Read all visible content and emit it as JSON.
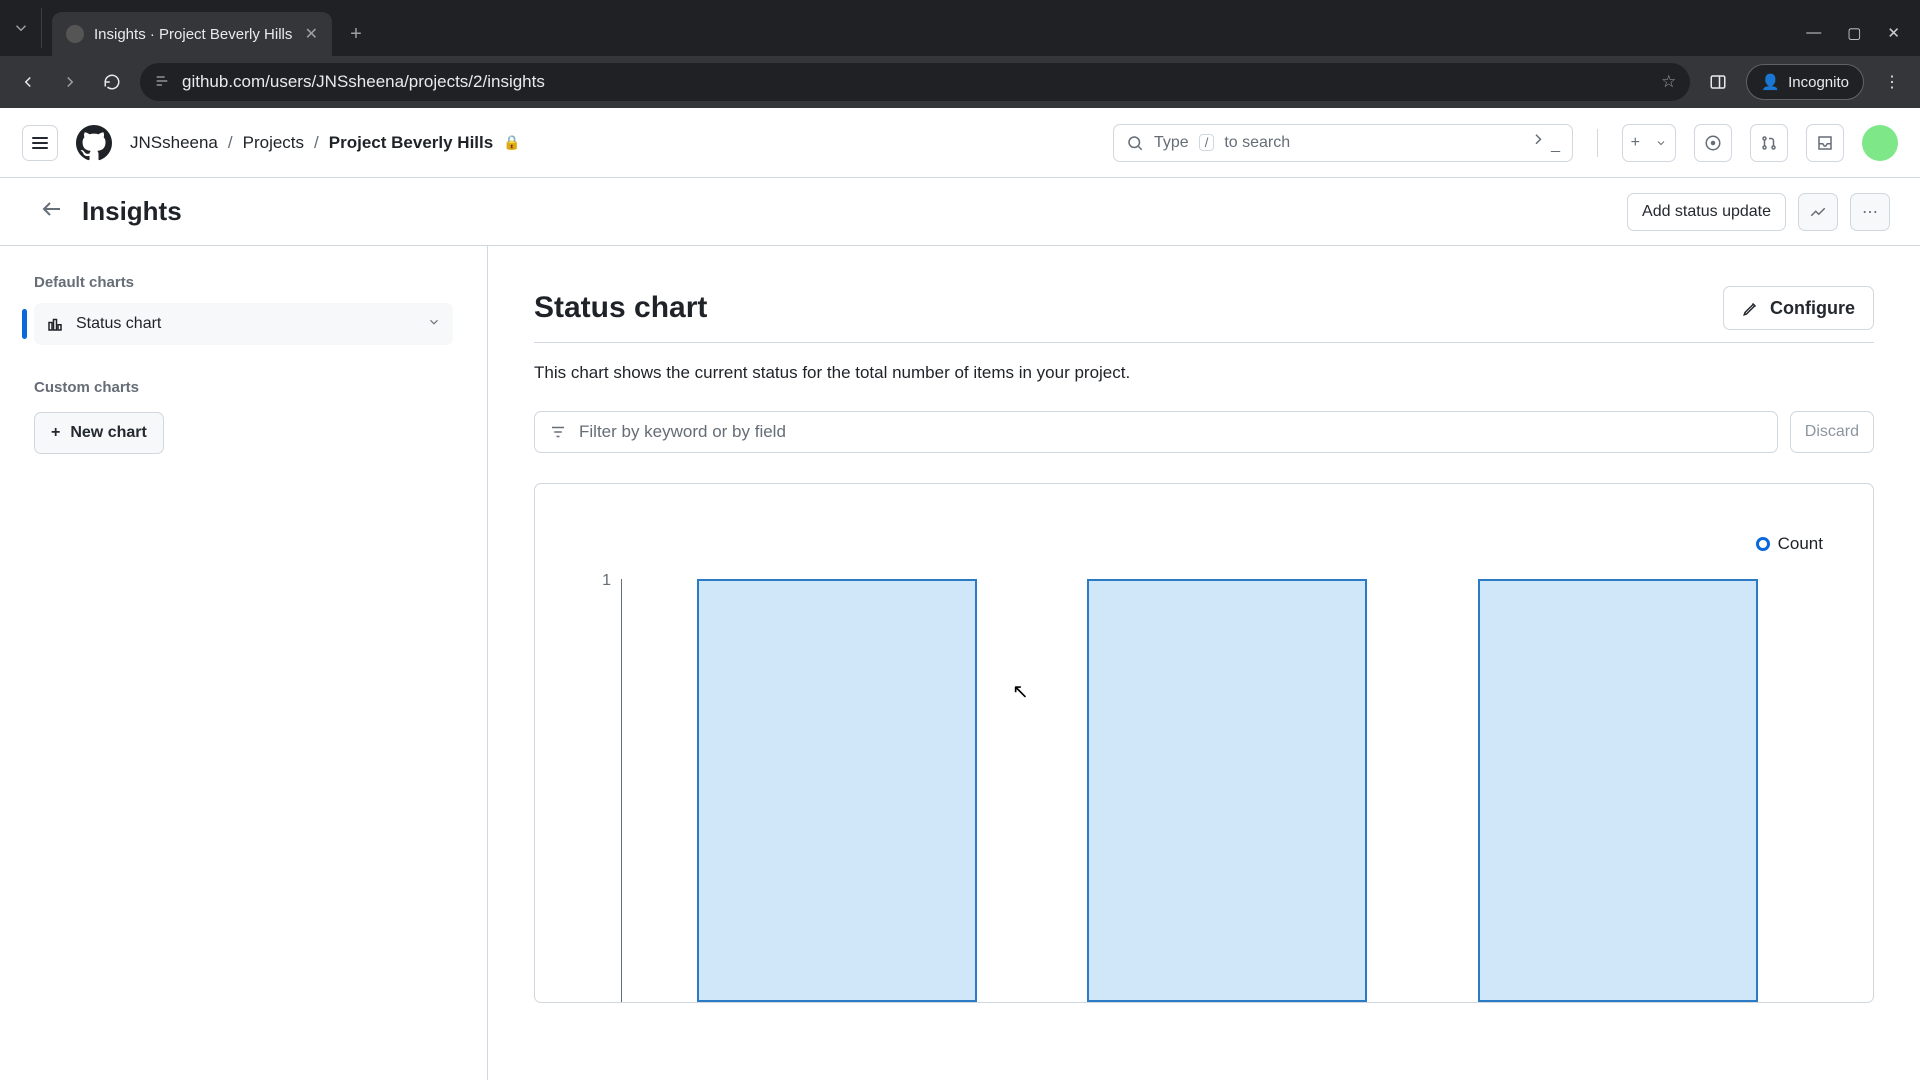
{
  "browser": {
    "tab_title": "Insights · Project Beverly Hills",
    "url": "github.com/users/JNSsheena/projects/2/insights",
    "incognito_label": "Incognito"
  },
  "header": {
    "user": "JNSsheena",
    "nav_projects": "Projects",
    "project_name": "Project Beverly Hills",
    "search_prefix": "Type",
    "search_key": "/",
    "search_suffix": "to search"
  },
  "subheader": {
    "title": "Insights",
    "add_status": "Add status update"
  },
  "sidebar": {
    "default_label": "Default charts",
    "status_chart": "Status chart",
    "custom_label": "Custom charts",
    "new_chart": "New chart"
  },
  "main": {
    "title": "Status chart",
    "configure": "Configure",
    "description": "This chart shows the current status for the total number of items in your project.",
    "filter_placeholder": "Filter by keyword or by field",
    "discard": "Discard",
    "legend": "Count",
    "ytick": "1"
  },
  "chart_data": {
    "type": "bar",
    "categories": [
      "",
      "",
      ""
    ],
    "values": [
      1,
      1,
      1
    ],
    "title": "Status chart",
    "xlabel": "",
    "ylabel": "Count",
    "ylim": [
      0,
      1
    ],
    "series": [
      {
        "name": "Count",
        "values": [
          1,
          1,
          1
        ]
      }
    ]
  }
}
